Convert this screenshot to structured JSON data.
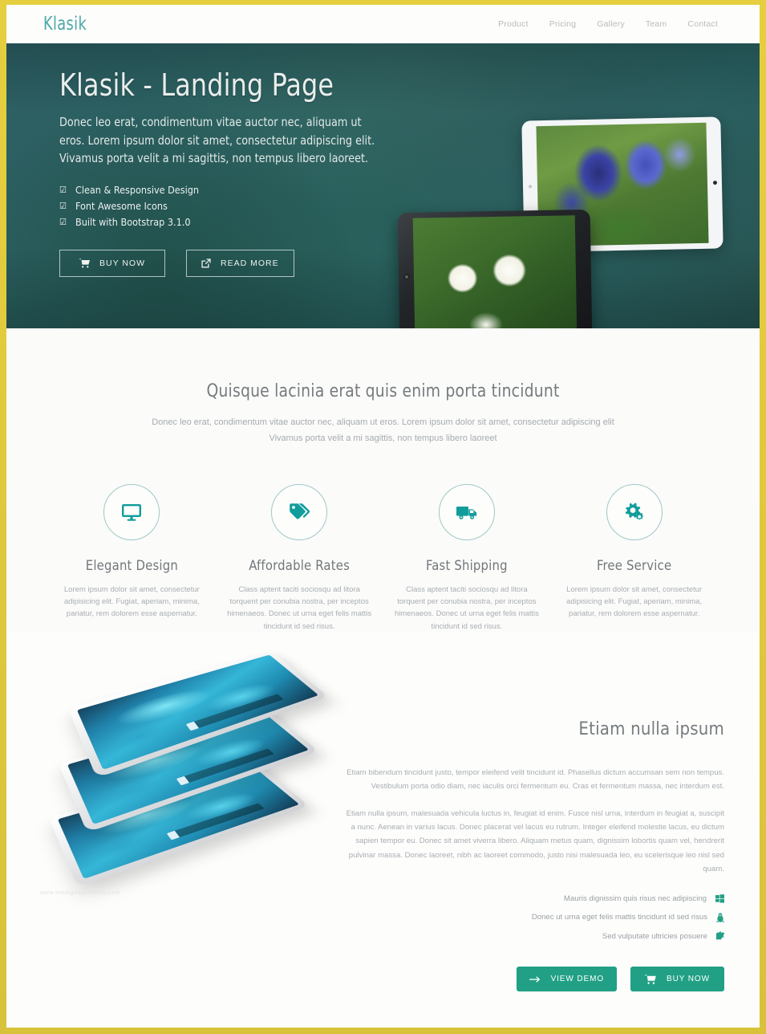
{
  "theme": {
    "frame_color": "#dcc63c",
    "brand_color": "#4aa8a8",
    "accent_teal": "#21a085",
    "hero_bg": "#2b6161",
    "muted_text": "#a9aeb1"
  },
  "navbar": {
    "brand": "Klasik",
    "links": [
      {
        "label": "Product"
      },
      {
        "label": "Pricing"
      },
      {
        "label": "Gallery"
      },
      {
        "label": "Team"
      },
      {
        "label": "Contact"
      }
    ]
  },
  "hero": {
    "title": "Klasik - Landing Page",
    "subtitle": "Donec leo erat, condimentum vitae auctor nec, aliquam ut eros. Lorem ipsum dolor sit amet, consectetur adipiscing elit. Vivamus porta velit a mi sagittis, non tempus libero laoreet.",
    "checklist": [
      {
        "icon": "check-square-icon",
        "label": "Clean & Responsive Design"
      },
      {
        "icon": "check-square-icon",
        "label": "Font Awesome Icons"
      },
      {
        "icon": "check-square-icon",
        "label": "Built with Bootstrap 3.1.0"
      }
    ],
    "buttons": [
      {
        "label": "BUY NOW",
        "icon": "shopping-cart-icon"
      },
      {
        "label": "READ MORE",
        "icon": "external-link-icon"
      }
    ],
    "devices": [
      {
        "name": "tablet-white-landscape",
        "content": "blue delphinium flowers photo"
      },
      {
        "name": "tablet-black-landscape",
        "content": "white daisy flowers photo"
      }
    ]
  },
  "features_section": {
    "title": "Quisque lacinia erat quis enim porta tincidunt",
    "subtitle": "Donec leo erat, condimentum vitae auctor nec, aliquam ut eros. Lorem ipsum dolor sit amet, consectetur adipiscing elit Vivamus porta velit a mi sagittis, non tempus libero laoreet",
    "items": [
      {
        "icon": "desktop-icon",
        "title": "Elegant Design",
        "text": "Lorem ipsum dolor sit amet, consectetur adipisicing elit. Fugiat, aperiam, minima, pariatur, rem dolorem esse aspernatur."
      },
      {
        "icon": "tags-icon",
        "title": "Affordable Rates",
        "text": "Class aptent taciti sociosqu ad litora torquent per conubia nostra, per inceptos himenaeos. Donec ut urna eget felis mattis tincidunt id sed risus."
      },
      {
        "icon": "truck-icon",
        "title": "Fast Shipping",
        "text": "Class aptent taciti sociosqu ad litora torquent per conubia nostra, per inceptos himenaeos. Donec ut urna eget felis mattis tincidunt id sed risus."
      },
      {
        "icon": "cogs-icon",
        "title": "Free Service",
        "text": "Lorem ipsum dolor sit amet, consectetur adipisicing elit. Fugiat, aperiam, minima, pariatur, rem dolorem esse aspernatur."
      }
    ]
  },
  "etiam_section": {
    "title": "Etiam nulla ipsum",
    "paragraph1": "Etiam bibendum tincidunt justo, tempor eleifend velit tincidunt id. Phasellus dictum accumsan sem non tempus. Vestibulum porta odio diam, nec iaculis orci fermentum eu. Cras et fermentum massa, nec interdum est.",
    "paragraph2": "Etiam nulla ipsum, malesuada vehicula luctus in, feugiat id enim. Fusce nisl urna, interdum in feugiat a, suscipit a nunc. Aenean in varius lacus. Donec placerat vel lacus eu rutrum. Integer eleifend molestie lacus, eu dictum sapien tempor eu. Donec sit amet viverra libero. Aliquam metus quam, dignissim lobortis quam vel, hendrerit pulvinar massa. Donec laoreet, nibh ac laoreet commodo, justo nisi malesuada leo, eu scelerisque leo nisl sed quam.",
    "os_list": [
      {
        "label": "Mauris dignissim quis risus nec adipiscing",
        "icon": "windows-icon"
      },
      {
        "label": "Donec ut urna eget felis mattis tincidunt id sed risus",
        "icon": "linux-icon"
      },
      {
        "label": "Sed vulputate ultricies posuere",
        "icon": "apple-icon"
      }
    ],
    "buttons": [
      {
        "label": "VIEW DEMO",
        "icon": "arrow-right-icon"
      },
      {
        "label": "BUY NOW",
        "icon": "shopping-cart-icon"
      }
    ],
    "image": {
      "name": "stacked-tablets-image",
      "alt": "three stacked white tablets with blue wave wallpaper"
    },
    "watermark": "www.thedigitalpictures.com"
  }
}
